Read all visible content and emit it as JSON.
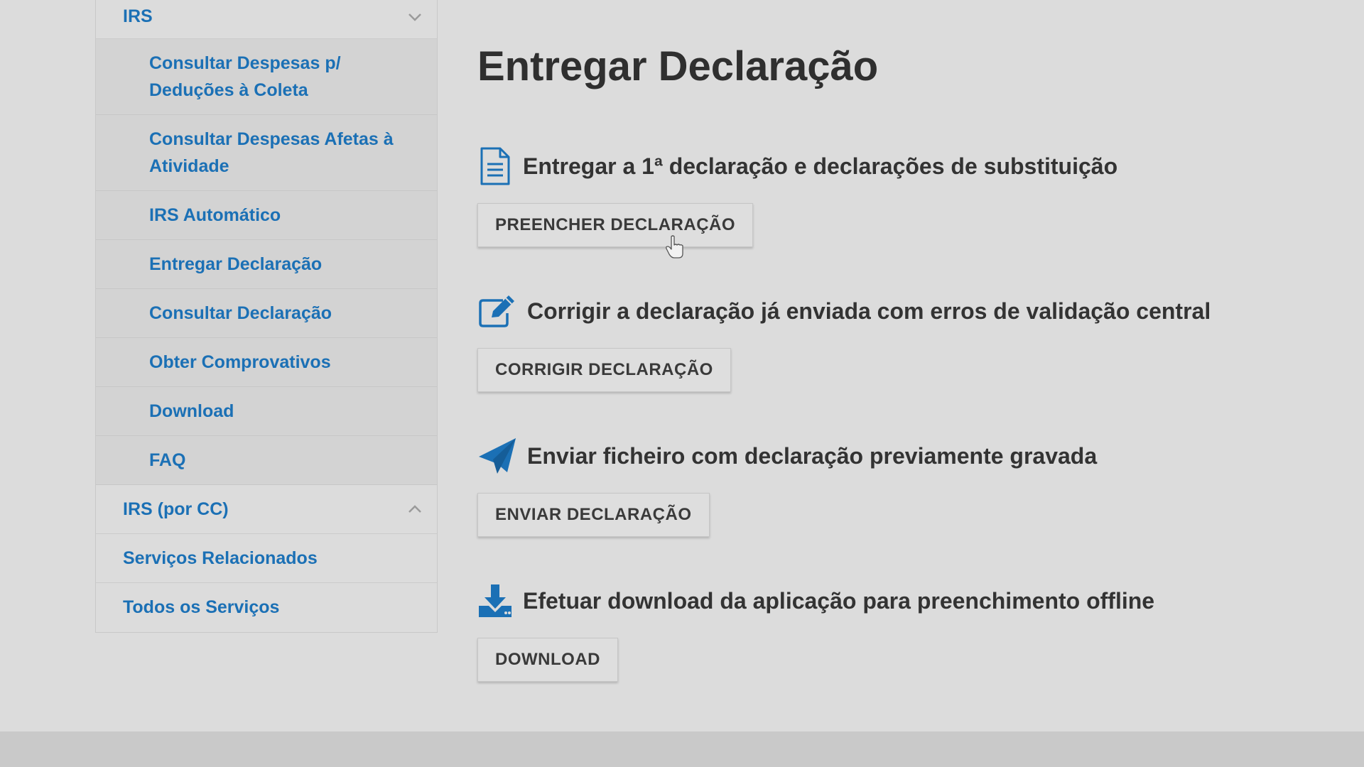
{
  "sidebar": {
    "irs_label": "IRS",
    "irs_items": [
      {
        "label": "Consultar Despesas p/ Deduções à Coleta"
      },
      {
        "label": "Consultar Despesas Afetas à Atividade"
      },
      {
        "label": "IRS Automático"
      },
      {
        "label": "Entregar Declaração"
      },
      {
        "label": "Consultar Declaração"
      },
      {
        "label": "Obter Comprovativos"
      },
      {
        "label": "Download"
      },
      {
        "label": "FAQ"
      }
    ],
    "irs_cc_label": "IRS (por CC)",
    "related_label": "Serviços Relacionados",
    "all_services_label": "Todos os Serviços"
  },
  "main": {
    "title": "Entregar Declaração",
    "sections": [
      {
        "icon": "document-icon",
        "title": "Entregar a 1ª declaração e declarações de substituição",
        "button": "PREENCHER DECLARAÇÃO"
      },
      {
        "icon": "edit-icon",
        "title": "Corrigir a declaração já enviada com erros de validação central",
        "button": "CORRIGIR DECLARAÇÃO"
      },
      {
        "icon": "paper-plane-icon",
        "title": "Enviar ficheiro com declaração previamente gravada",
        "button": "ENVIAR DECLARAÇÃO"
      },
      {
        "icon": "download-icon",
        "title": "Efetuar download da aplicação para preenchimento offline",
        "button": "DOWNLOAD"
      }
    ]
  },
  "colors": {
    "link": "#1b70b5",
    "text": "#333333",
    "background": "#dcdcdc",
    "submenu_background": "#d3d3d3"
  }
}
